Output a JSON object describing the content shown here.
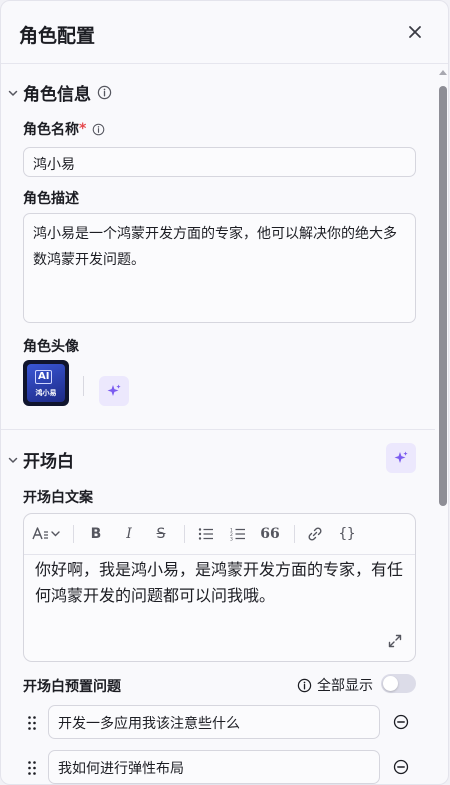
{
  "header": {
    "title": "角色配置"
  },
  "role_info": {
    "section_title": "角色信息",
    "name_label": "角色名称",
    "required_mark": "*",
    "name_value": "鸿小易",
    "desc_label": "角色描述",
    "desc_value": "鸿小易是一个鸿蒙开发方面的专家，他可以解决你的绝大多数鸿蒙开发问题。",
    "avatar_label": "角色头像",
    "avatar_badge": "AI",
    "avatar_caption": "鸿小易"
  },
  "opening": {
    "section_title": "开场白",
    "text_label": "开场白文案",
    "text_value": "你好啊，我是鸿小易，是鸿蒙开发方面的专家，有任何鸿蒙开发的问题都可以问我哦。",
    "toolbar": {
      "bold": "B",
      "italic": "I",
      "strike": "S",
      "quote": "66",
      "code": "{}"
    },
    "preset_label": "开场白预置问题",
    "show_all_label": "全部显示",
    "show_all_enabled": false,
    "questions": [
      {
        "text": "开发一多应用我该注意些什么"
      },
      {
        "text": "我如何进行弹性布局"
      }
    ]
  },
  "colors": {
    "accent": "#7b5cf0",
    "accent_bg": "#ece8fd",
    "required": "#e5484d"
  },
  "icons": [
    "close-icon",
    "info-icon",
    "chevron-down-icon",
    "sparkle-icon",
    "expand-icon",
    "drag-handle-icon",
    "remove-icon",
    "link-icon"
  ]
}
